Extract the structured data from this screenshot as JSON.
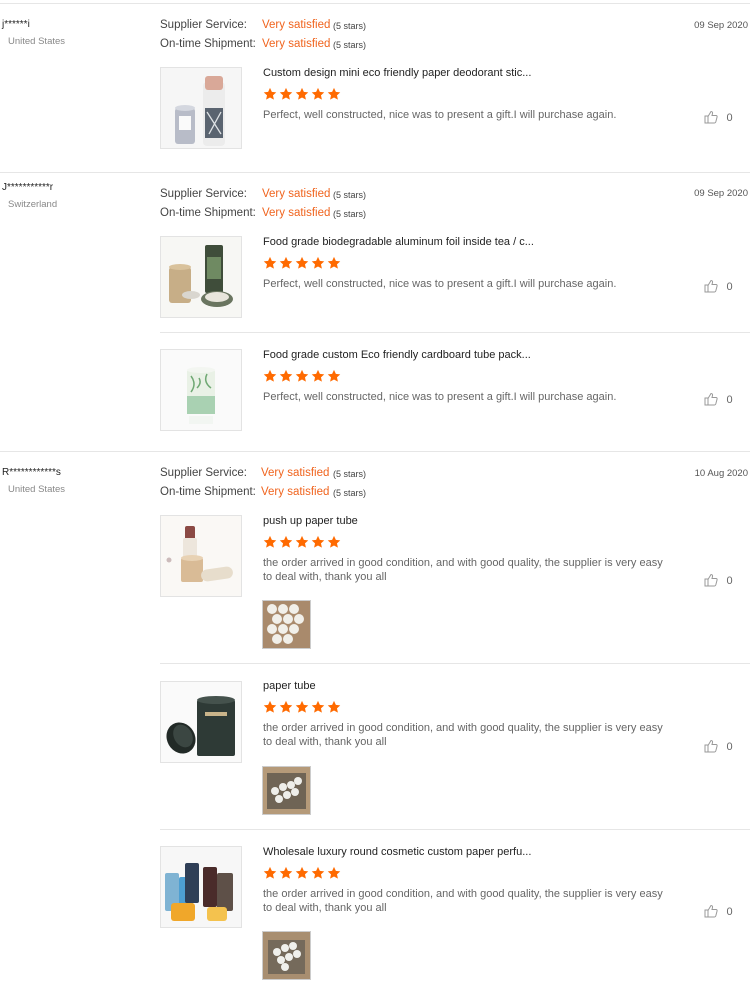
{
  "labels": {
    "supplier_service": "Supplier Service:",
    "on_time_shipment": "On-time Shipment:"
  },
  "reviews": [
    {
      "user": "j******i",
      "country": "United States",
      "supplier_rating": "Very satisfied",
      "supplier_stars": "(5 stars)",
      "shipment_rating": "Very satisfied",
      "shipment_stars": "(5 stars)",
      "date": "09 Sep 2020",
      "products": [
        {
          "title": "Custom design mini eco friendly paper deodorant stic...",
          "rating": 5,
          "text": "Perfect, well constructed, nice was to present a gift.I will purchase again.",
          "likes": "0",
          "thumb_icon": "deodorant-tube-photo"
        }
      ]
    },
    {
      "user": "J***********r",
      "country": "Switzerland",
      "supplier_rating": "Very satisfied",
      "supplier_stars": "(5 stars)",
      "shipment_rating": "Very satisfied",
      "shipment_stars": "(5 stars)",
      "date": "09 Sep 2020",
      "products": [
        {
          "title": "Food grade biodegradable aluminum foil inside tea / c...",
          "rating": 5,
          "text": "Perfect, well constructed, nice was to present a gift.I will purchase again.",
          "likes": "0",
          "thumb_icon": "tea-tube-photo"
        },
        {
          "title": "Food grade custom Eco friendly cardboard tube pack...",
          "rating": 5,
          "text": "Perfect, well constructed, nice was to present a gift.I will purchase again.",
          "likes": "0",
          "thumb_icon": "green-tube-photo"
        }
      ]
    },
    {
      "user": "R************s",
      "country": "United States",
      "supplier_rating": "Very satisfied",
      "supplier_stars": "(5 stars)",
      "shipment_rating": "Very satisfied",
      "shipment_stars": "(5 stars)",
      "date": "10 Aug 2020",
      "products": [
        {
          "title": "push up paper tube",
          "rating": 5,
          "text": "the order arrived in good condition, and with good quality, the supplier is very easy to deal with, thank you all",
          "likes": "0",
          "thumb_icon": "push-up-tube-photo"
        },
        {
          "title": "paper tube",
          "rating": 5,
          "text": "the order arrived in good condition, and with good quality, the supplier is very easy to deal with, thank you all",
          "likes": "0",
          "thumb_icon": "black-tube-photo"
        },
        {
          "title": "Wholesale luxury round cosmetic custom paper perfu...",
          "rating": 5,
          "text": "the order arrived in good condition, and with good quality, the supplier is very easy to deal with, thank you all",
          "likes": "0",
          "thumb_icon": "cosmetic-tubes-photo"
        }
      ]
    }
  ],
  "colors": {
    "accent": "#f0641e",
    "star": "#ff6a00",
    "rule": "#e6e6e6"
  }
}
